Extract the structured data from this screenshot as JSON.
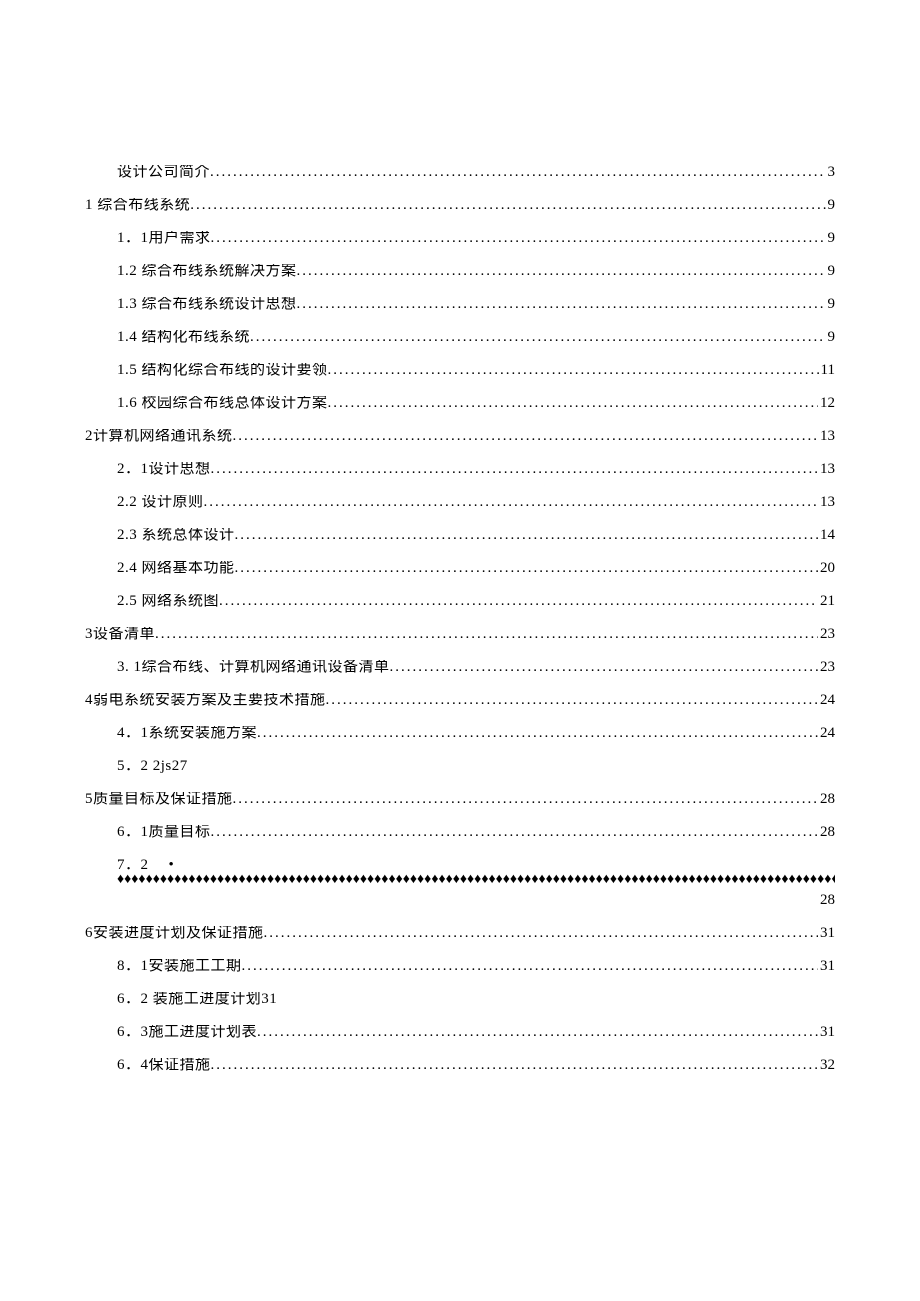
{
  "toc": {
    "entries": [
      {
        "level": 2,
        "title": "设计公司简介",
        "page": "3",
        "style": "dots"
      },
      {
        "level": 1,
        "title": "1 综合布线系统",
        "page": "9",
        "style": "dots"
      },
      {
        "level": 2,
        "title": "1．1用户需求",
        "page": "9",
        "style": "dots"
      },
      {
        "level": 2,
        "title": "1.2 综合布线系统解决方案",
        "page": "9",
        "style": "dots"
      },
      {
        "level": 2,
        "title": "1.3 综合布线系统设计思想",
        "page": "9",
        "style": "dots"
      },
      {
        "level": 2,
        "title": "1.4 结构化布线系统",
        "page": "9",
        "style": "dots"
      },
      {
        "level": 2,
        "title": "1.5 结构化综合布线的设计要领",
        "page": " 11",
        "style": "dots"
      },
      {
        "level": 2,
        "title": "1.6 校园综合布线总体设计方案",
        "page": "12",
        "style": "dots"
      },
      {
        "level": 1,
        "title": "2计算机网络通讯系统",
        "page": "13",
        "style": "dots"
      },
      {
        "level": 2,
        "title": "2．1设计思想",
        "page": "13",
        "style": "dots"
      },
      {
        "level": 2,
        "title": "2.2  设计原则",
        "page": "13",
        "style": "dots"
      },
      {
        "level": 2,
        "title": "2.3  系统总体设计",
        "page": "14",
        "style": "dots"
      },
      {
        "level": 2,
        "title": "2.4  网络基本功能",
        "page": " 20",
        "style": "dots"
      },
      {
        "level": 2,
        "title": "2.5  网络系统图",
        "page": "21",
        "style": "dots"
      },
      {
        "level": 1,
        "title": "3设备清单",
        "page": "23",
        "style": "dots"
      },
      {
        "level": 2,
        "title": "3. 1综合布线、计算机网络通讯设备清单",
        "page": "23",
        "style": "dots"
      },
      {
        "level": 1,
        "title": "4弱电系统安装方案及主要技术措施",
        "page": "24",
        "style": "dots"
      },
      {
        "level": 2,
        "title": "4．1系统安装施方案",
        "page": "24",
        "style": "dots"
      },
      {
        "level": 2,
        "title": "5．2 2js27",
        "page": "",
        "style": "none"
      },
      {
        "level": 1,
        "title": "5质量目标及保证措施",
        "page": " 28",
        "style": "dots"
      },
      {
        "level": 2,
        "title": "6．1质量目标",
        "page": "28",
        "style": "dots"
      },
      {
        "level": 2,
        "title": "7．2",
        "page": "28",
        "style": "diamonds",
        "predot": "•"
      },
      {
        "level": 1,
        "title": "6安装进度计划及保证措施",
        "page": " 31",
        "style": "dots"
      },
      {
        "level": 2,
        "title": "8．1安装施工工期",
        "page": "31",
        "style": "dots"
      },
      {
        "level": 2,
        "title": "6．2 装施工进度计划31",
        "page": "",
        "style": "none"
      },
      {
        "level": 2,
        "title": "6．3施工进度计划表",
        "page": "31",
        "style": "dots"
      },
      {
        "level": 2,
        "title": "6．4保证措施",
        "page": "32",
        "style": "dots"
      }
    ]
  }
}
